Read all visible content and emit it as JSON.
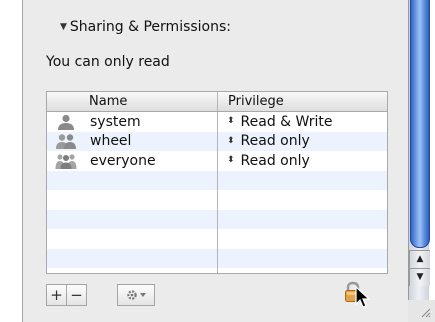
{
  "section": {
    "title": "Sharing & Permissions:",
    "permission_text": "You can only read"
  },
  "table": {
    "columns": {
      "name": "Name",
      "privilege": "Privilege"
    },
    "rows": [
      {
        "name": "system",
        "privilege": "Read & Write",
        "icon": "user-single-icon"
      },
      {
        "name": "wheel",
        "privilege": "Read only",
        "icon": "group-icon"
      },
      {
        "name": "everyone",
        "privilege": "Read only",
        "icon": "everyone-icon"
      }
    ]
  },
  "buttons": {
    "add": "+",
    "remove": "−",
    "action_icon": "gear-icon"
  },
  "icons": {
    "lock": "lock-icon",
    "cursor": "arrow-cursor-icon"
  },
  "colors": {
    "scroll_thumb": "#4a7fd6",
    "row_alt": "#edf3fe",
    "panel": "#ebebeb"
  }
}
